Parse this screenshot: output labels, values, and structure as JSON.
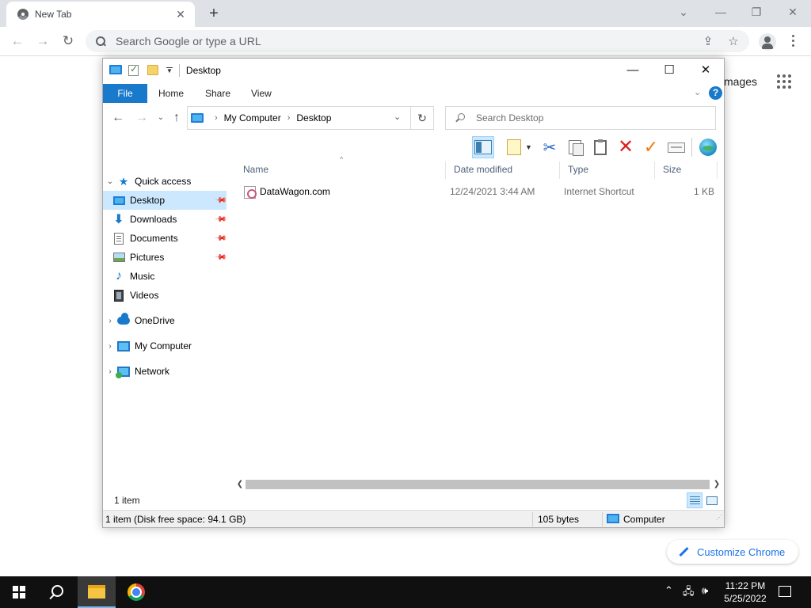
{
  "chrome": {
    "tab_title": "New Tab",
    "tab_close": "✕",
    "new_tab": "+",
    "omnibox_placeholder": "Search Google or type a URL",
    "ntp_images_link": "mages",
    "customize_label": "Customize Chrome"
  },
  "explorer": {
    "window_title": "Desktop",
    "ribbon_tabs": [
      "File",
      "Home",
      "Share",
      "View"
    ],
    "breadcrumbs": [
      "My Computer",
      "Desktop"
    ],
    "search_placeholder": "Search Desktop",
    "nav": {
      "quick_access": "Quick access",
      "desktop": "Desktop",
      "downloads": "Downloads",
      "documents": "Documents",
      "pictures": "Pictures",
      "music": "Music",
      "videos": "Videos",
      "onedrive": "OneDrive",
      "my_computer": "My Computer",
      "network": "Network"
    },
    "columns": {
      "name": "Name",
      "date_modified": "Date modified",
      "type": "Type",
      "size": "Size"
    },
    "files": [
      {
        "name": "DataWagon.com",
        "date_modified": "12/24/2021 3:44 AM",
        "type": "Internet Shortcut",
        "size": "1 KB"
      }
    ],
    "item_count": "1 item",
    "status": {
      "disk_info": "1 item (Disk free space: 94.1 GB)",
      "bytes": "105 bytes",
      "location": "Computer"
    },
    "icons": {
      "toolbar": [
        "preview-pane-icon",
        "new-folder-icon",
        "cut-icon",
        "copy-icon",
        "paste-icon",
        "delete-icon",
        "check-icon",
        "rename-icon",
        "globe-icon"
      ]
    },
    "colors": {
      "accent": "#1979ca",
      "selection": "#cce8ff"
    }
  },
  "taskbar": {
    "time": "11:22 PM",
    "date": "5/25/2022"
  }
}
